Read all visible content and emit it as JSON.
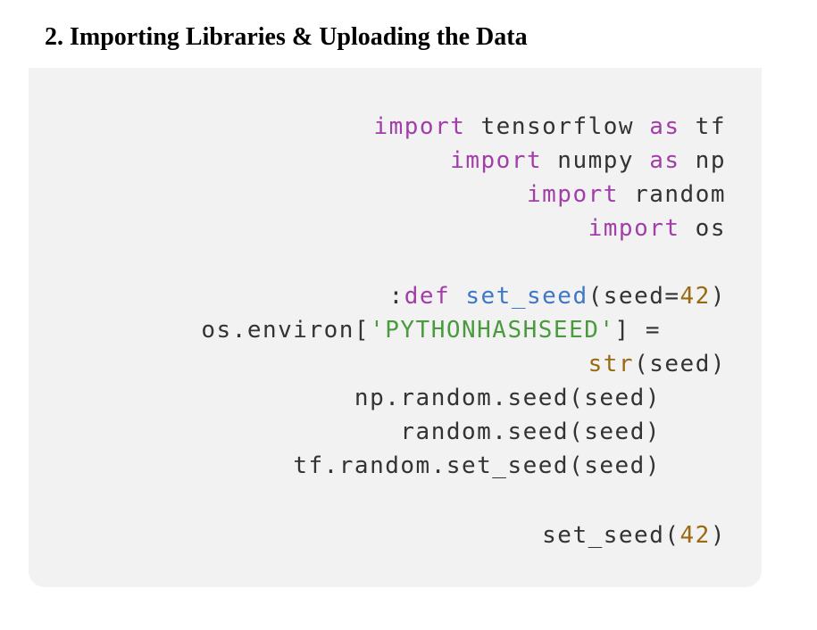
{
  "heading": "2. Importing Libraries & Uploading the Data",
  "code": {
    "l1": {
      "kw": "import",
      "rest": " tensorflow ",
      "kw2": "as",
      "rest2": " tf"
    },
    "l2": {
      "kw": "import",
      "rest": " numpy ",
      "kw2": "as",
      "rest2": " np"
    },
    "l3": {
      "kw": "import",
      "rest": " random"
    },
    "l4": {
      "kw": "import",
      "rest": " os"
    },
    "l5": {
      "colon": ":",
      "kw": "def",
      "sp": " ",
      "fn": "set_seed",
      "open": "(seed=",
      "num": "42",
      "close": ")"
    },
    "l6": {
      "pre": "os.environ[",
      "str": "'PYTHONHASHSEED'",
      "post": "] ="
    },
    "l7": {
      "bi": "str",
      "rest": "(seed)"
    },
    "l8": {
      "text": "np.random.seed(seed)"
    },
    "l9": {
      "text": "random.seed(seed)"
    },
    "l10": {
      "text": "tf.random.set_seed(seed)"
    },
    "l11": {
      "pre": "set_seed(",
      "num": "42",
      "post": ")"
    }
  },
  "colors": {
    "keyword": "#a23ea8",
    "function": "#3e78c4",
    "number": "#9a6a12",
    "string": "#4a9a3e",
    "text": "#333333",
    "background": "#f2f2f2"
  }
}
